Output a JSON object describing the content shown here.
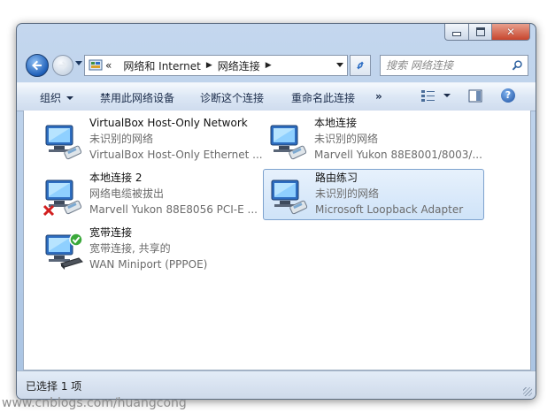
{
  "window": {
    "minimize_symbol": "—",
    "close_symbol": "✕"
  },
  "nav": {
    "breadcrumb_lead": "«",
    "breadcrumb": [
      "网络和 Internet",
      "网络连接"
    ],
    "breadcrumb_sep": "▶",
    "search_placeholder": "搜索 网络连接",
    "accent": "#1e5fb8"
  },
  "toolbar": {
    "organize": "组织",
    "disable": "禁用此网络设备",
    "diagnose": "诊断这个连接",
    "rename": "重命名此连接",
    "more": "»",
    "help": "?"
  },
  "connections": [
    {
      "name": "VirtualBox Host-Only Network",
      "status": "未识别的网络",
      "device": "VirtualBox Host-Only Ethernet ...",
      "icon": "network-adapter-icon",
      "selected": false
    },
    {
      "name": "本地连接",
      "status": "未识别的网络",
      "device": "Marvell Yukon 88E8001/8003/...",
      "icon": "network-adapter-icon",
      "selected": false
    },
    {
      "name": "本地连接 2",
      "status": "网络电缆被拔出",
      "device": "Marvell Yukon 88E8056 PCI-E ...",
      "icon": "network-adapter-disconnected-icon",
      "selected": false
    },
    {
      "name": "路由练习",
      "status": "未识别的网络",
      "device": "Microsoft Loopback Adapter",
      "icon": "network-adapter-icon",
      "selected": true
    },
    {
      "name": "宽带连接",
      "status": "宽带连接, 共享的",
      "device": "WAN Miniport (PPPOE)",
      "icon": "broadband-connected-icon",
      "selected": false
    }
  ],
  "statusbar": {
    "text": "已选择 1 项"
  },
  "watermark": "www.cnblogs.com/huangcong"
}
